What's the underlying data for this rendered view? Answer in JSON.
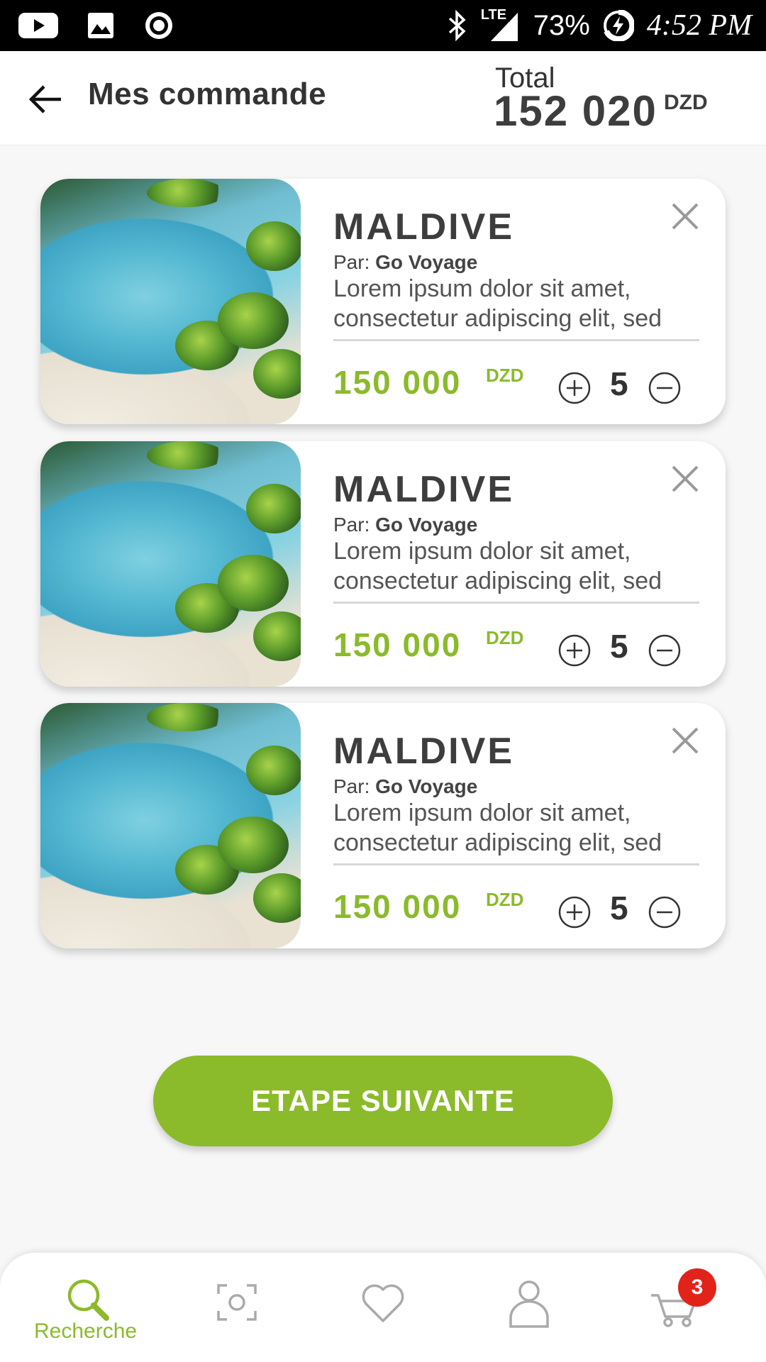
{
  "status_bar": {
    "battery": "73%",
    "network": "LTE",
    "time": "4:52 PM"
  },
  "header": {
    "title": "Mes commande",
    "total_label": "Total",
    "total_amount": "152 020",
    "total_currency": "DZD"
  },
  "items": [
    {
      "title": "MALDIVE",
      "vendor_prefix": "Par:",
      "vendor": "Go Voyage",
      "description": "Lorem ipsum dolor sit amet, consectetur adipiscing elit, sed",
      "price": "150 000",
      "currency": "DZD",
      "quantity": "5"
    },
    {
      "title": "MALDIVE",
      "vendor_prefix": "Par:",
      "vendor": "Go Voyage",
      "description": "Lorem ipsum dolor sit amet, consectetur adipiscing elit, sed",
      "price": "150 000",
      "currency": "DZD",
      "quantity": "5"
    },
    {
      "title": "MALDIVE",
      "vendor_prefix": "Par:",
      "vendor": "Go Voyage",
      "description": "Lorem ipsum dolor sit amet, consectetur adipiscing elit, sed",
      "price": "150 000",
      "currency": "DZD",
      "quantity": "5"
    }
  ],
  "next_button": "ETAPE SUIVANTE",
  "bottom_nav": {
    "items": [
      {
        "icon": "search-icon",
        "label": "Recherche",
        "active": true
      },
      {
        "icon": "scan-icon",
        "label": "",
        "active": false
      },
      {
        "icon": "heart-icon",
        "label": "",
        "active": false
      },
      {
        "icon": "profile-icon",
        "label": "",
        "active": false
      },
      {
        "icon": "cart-icon",
        "label": "",
        "active": false
      }
    ],
    "cart_count": "3"
  },
  "colors": {
    "accent": "#8bba2b",
    "badge": "#e2231a",
    "text": "#3d3d3d"
  }
}
